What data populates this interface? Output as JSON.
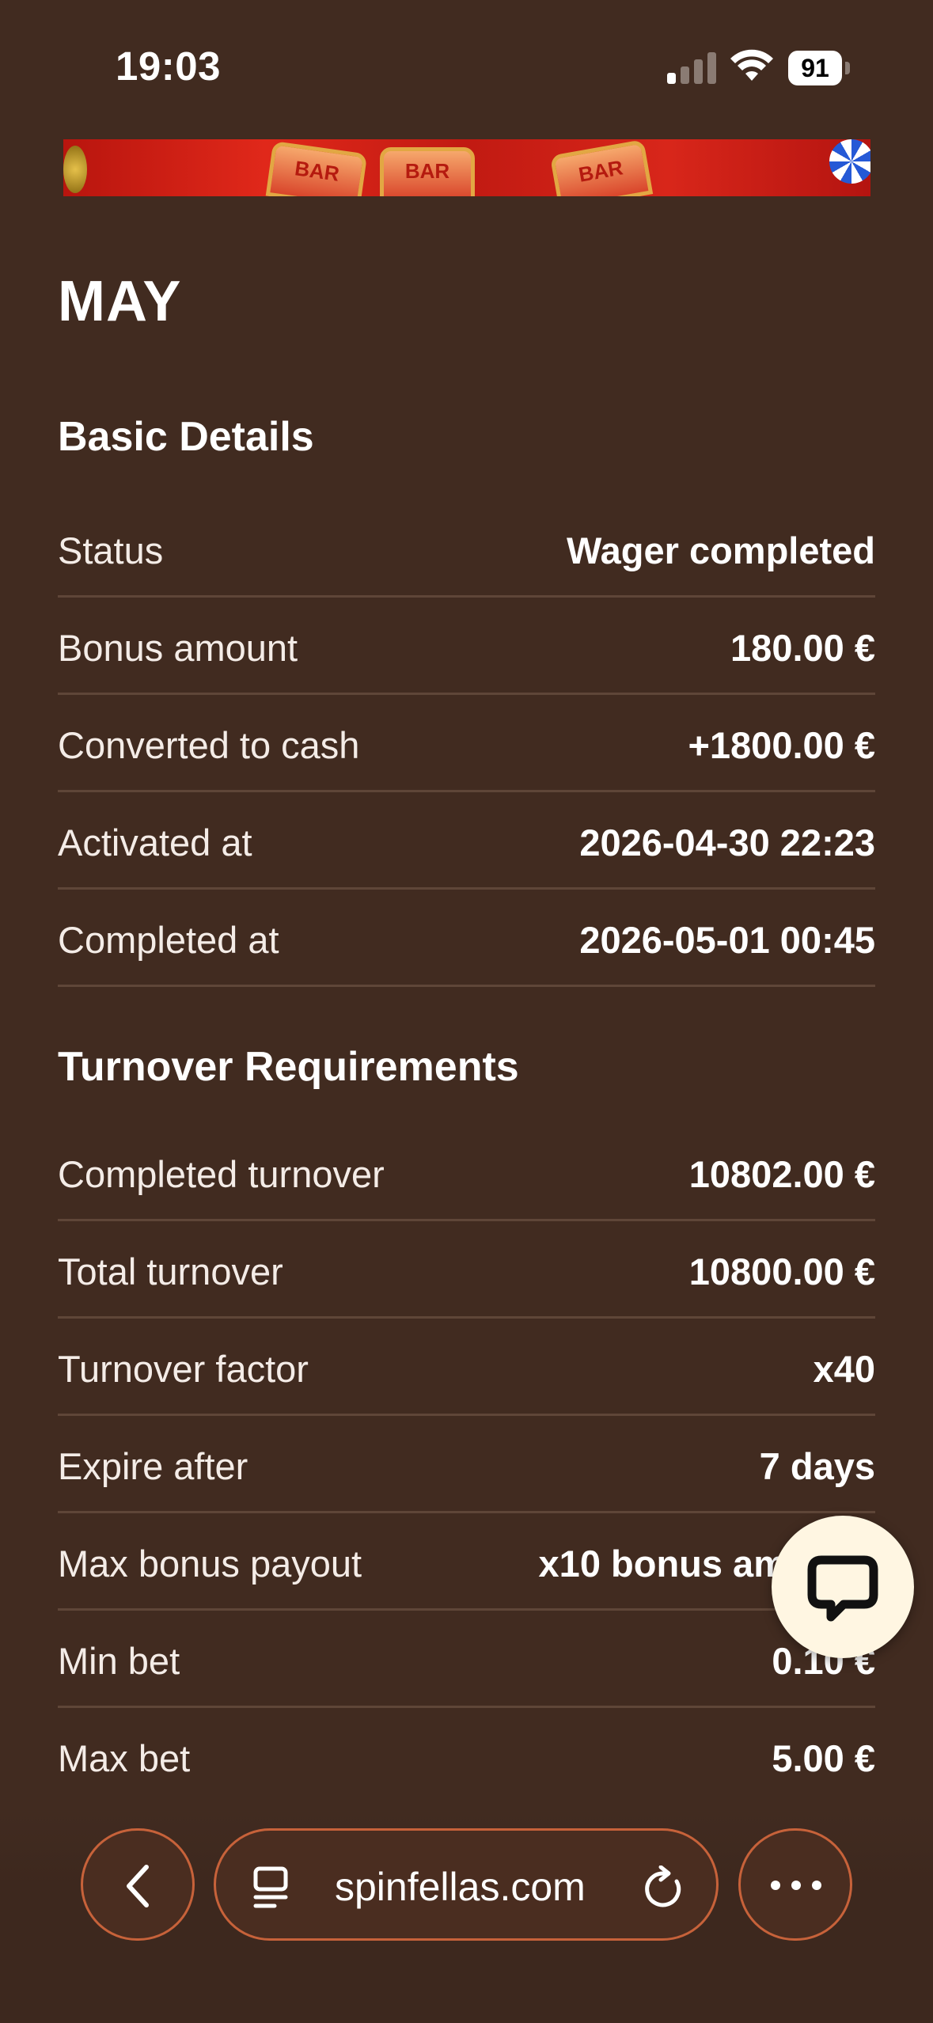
{
  "status_bar": {
    "time": "19:03",
    "battery": "91",
    "icons": [
      "cellular-signal-icon",
      "wifi-icon",
      "battery-icon"
    ]
  },
  "banner": {
    "reel_labels": [
      "BAR",
      "BAR",
      "BAR"
    ]
  },
  "page": {
    "title": "MAY"
  },
  "basic_details": {
    "heading": "Basic Details",
    "rows": [
      {
        "label": "Status",
        "value": "Wager completed"
      },
      {
        "label": "Bonus amount",
        "value": "180.00 €"
      },
      {
        "label": "Converted to cash",
        "value": "+1800.00 €"
      },
      {
        "label": "Activated at",
        "value": "2026-04-30 22:23"
      },
      {
        "label": "Completed at",
        "value": "2026-05-01 00:45"
      }
    ]
  },
  "turnover": {
    "heading": "Turnover Requirements",
    "rows": [
      {
        "label": "Completed turnover",
        "value": "10802.00 €"
      },
      {
        "label": "Total turnover",
        "value": "10800.00 €"
      },
      {
        "label": "Turnover factor",
        "value": "x40"
      },
      {
        "label": "Expire after",
        "value": "7 days"
      },
      {
        "label": "Max bonus payout",
        "value": "x10 bonus am"
      },
      {
        "label": "Min bet",
        "value": "0.10 €"
      },
      {
        "label": "Max bet",
        "value": "5.00 €"
      }
    ]
  },
  "browser": {
    "url": "spinfellas.com",
    "icons": [
      "back-chevron-icon",
      "tabs-icon",
      "reload-icon",
      "more-dots-icon",
      "chat-bubble-icon"
    ]
  },
  "colors": {
    "background": "#412b20",
    "divider": "#5f4638",
    "accent_border": "#c7623a",
    "chat_button": "#fff6e2"
  }
}
